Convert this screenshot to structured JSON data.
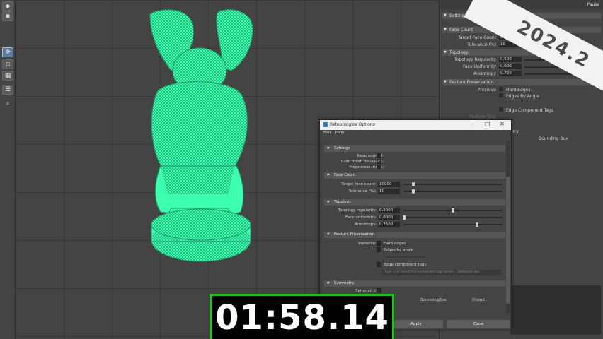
{
  "badge": {
    "version": "2024.2"
  },
  "timer": {
    "time": "01:58.14"
  },
  "left_toolbar": {
    "tools": [
      "select-tool",
      "lasso-tool",
      "paint-tool",
      "move-tool",
      "layout-single",
      "layout-four",
      "layout-two",
      "outliner",
      "search-tool"
    ]
  },
  "attribute_editor": {
    "pause_label": "Pause",
    "sections": {
      "settings": "Settings",
      "face_count": "Face Count",
      "topology": "Topology",
      "feature_preservation": "Feature Preservation"
    },
    "target_face_count_label": "Target Face Count",
    "target_face_count_value": "10000",
    "tolerance_label": "Tolerance (%)",
    "tolerance_value": "10",
    "topology_regularity_label": "Topology Regularity",
    "topology_regularity_value": "0.500",
    "face_uniformity_label": "Face Uniformity",
    "face_uniformity_value": "0.000",
    "anisotropy_label": "Anisotropy",
    "anisotropy_value": "0.750",
    "preserve_label": "Preserve",
    "hard_edges_label": "Hard Edges",
    "edges_by_angle_label": "Edges By Angle",
    "edge_component_tags_label": "Edge Component Tags",
    "feature_tags_label": "Feature Tags",
    "symmetry_partial": "etry",
    "bounding_box_label": "Bounding Box"
  },
  "dialog": {
    "title": "Retopologize Options",
    "menu": {
      "edit": "Edit",
      "help": "Help"
    },
    "sections": {
      "settings": "Settings",
      "face_count": "Face Count",
      "topology": "Topology",
      "feature_preservation": "Feature Preservation",
      "symmetry": "Symmetry"
    },
    "keep_original_label": "Keep original:",
    "keep_original_checked": false,
    "scan_mesh_label": "Scan mesh for issues:",
    "scan_mesh_checked": true,
    "preprocess_mesh_label": "Preprocess mesh:",
    "preprocess_mesh_checked": false,
    "target_face_count_label": "Target face count:",
    "target_face_count_value": "10000",
    "target_face_count_slider": 0.05,
    "tolerance_label": "Tolerance (%):",
    "tolerance_value": "10",
    "tolerance_slider": 0.05,
    "topology_regularity_label": "Topology regularity:",
    "topology_regularity_value": "0.5000",
    "topology_regularity_slider": 0.5,
    "face_uniformity_label": "Face uniformity:",
    "face_uniformity_value": "0.0000",
    "face_uniformity_slider": 0.0,
    "anisotropy_label": "Anisotropy:",
    "anisotropy_value": "0.7500",
    "anisotropy_slider": 0.75,
    "preserve_label": "Preserve:",
    "hard_edges_label": "Hard edges",
    "edges_by_angle_label": "Edges by angle",
    "edge_component_tags_label": "Edge component tags",
    "tags_placeholder": "Type in or select the component tag names... Wildcards are...",
    "symmetry_label": "Symmetry:",
    "bounding_box_label": "BoundingBox",
    "object_label": "Object",
    "apply_label": "Apply",
    "close_label": "Close"
  },
  "colors": {
    "wireframe": "#3dffb0",
    "timer_border": "#1fc21f",
    "viewport_bg": "#444444"
  }
}
